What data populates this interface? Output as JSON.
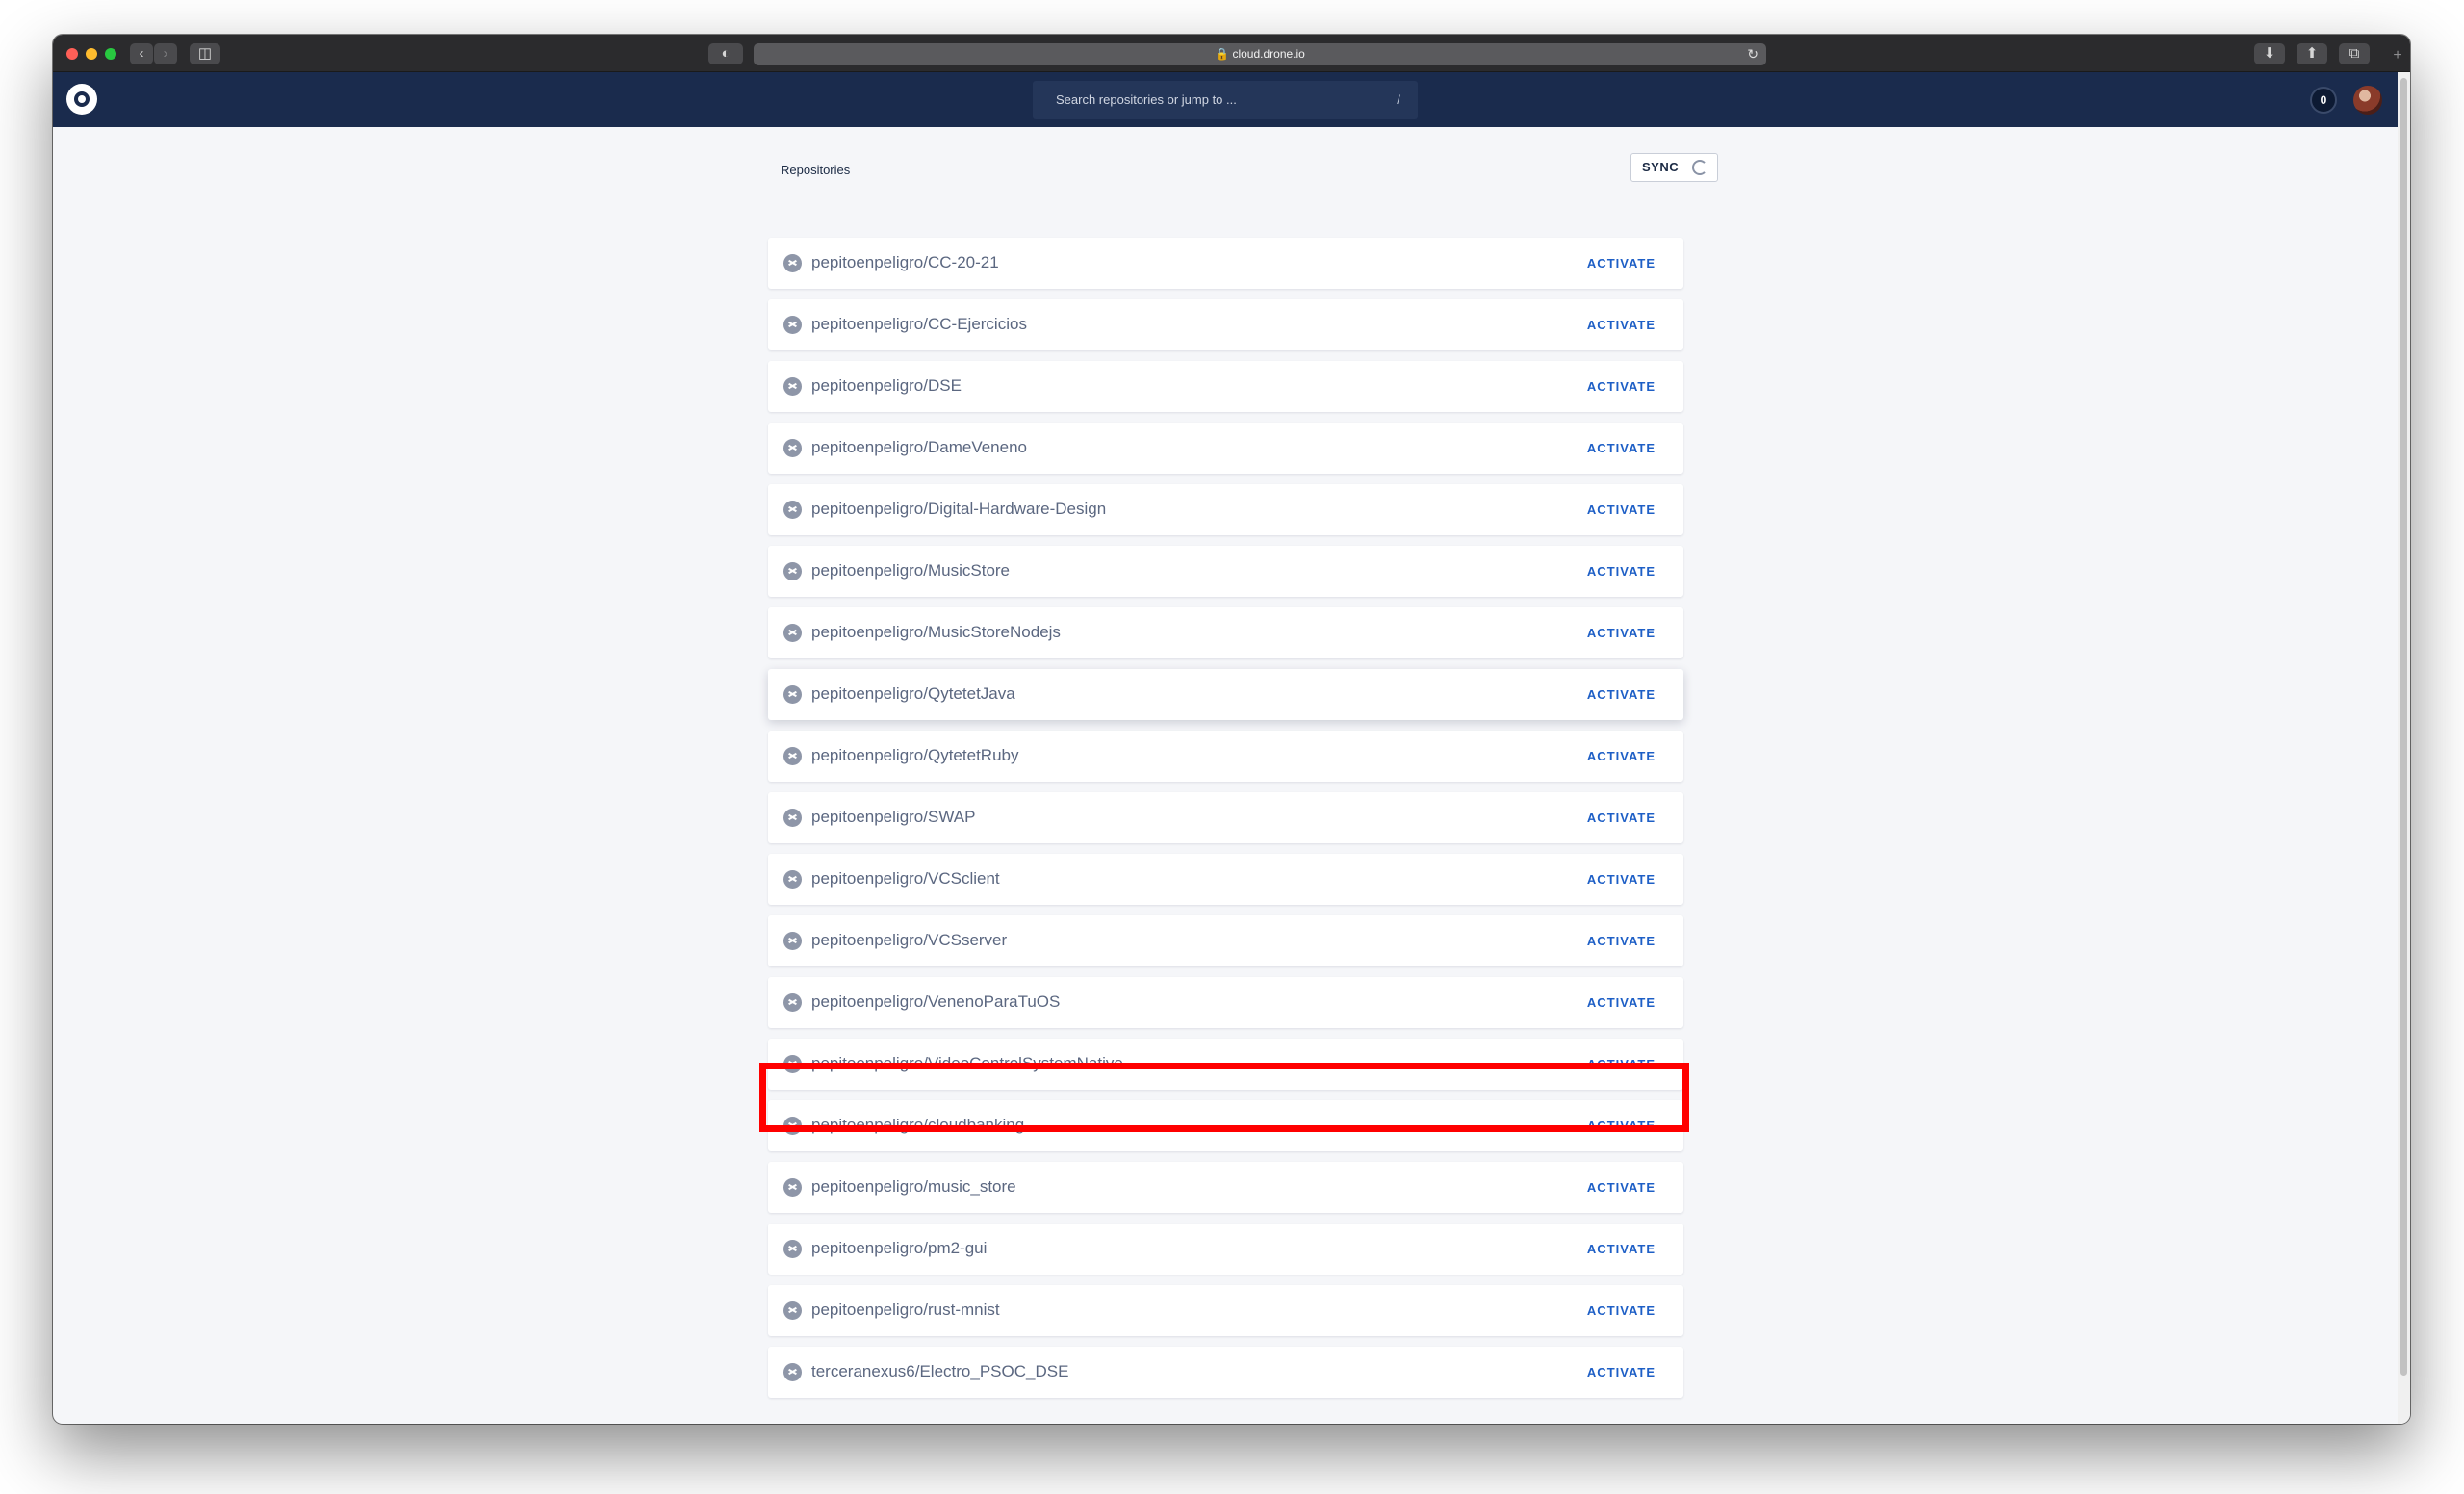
{
  "browser": {
    "url": "cloud.drone.io",
    "icons": {
      "back": "chevron-left-icon",
      "forward": "chevron-right-icon",
      "sidebar": "sidebar-icon",
      "privacy": "shield-icon",
      "lock": "lock-icon",
      "reload": "reload-icon",
      "download": "download-icon",
      "share": "share-icon",
      "tabs": "tabs-icon",
      "new_tab": "plus-icon"
    }
  },
  "header": {
    "search_placeholder": "Search repositories or jump to ...",
    "search_shortcut": "/",
    "notification_count": "0",
    "colors": {
      "background": "#1a2b4d"
    }
  },
  "repositories": {
    "title": "Repositories",
    "sync_label": "SYNC",
    "activate_label": "ACTIVATE",
    "items": [
      {
        "name": "pepitoenpeligro/CC-20-21"
      },
      {
        "name": "pepitoenpeligro/CC-Ejercicios"
      },
      {
        "name": "pepitoenpeligro/DSE"
      },
      {
        "name": "pepitoenpeligro/DameVeneno"
      },
      {
        "name": "pepitoenpeligro/Digital-Hardware-Design"
      },
      {
        "name": "pepitoenpeligro/MusicStore"
      },
      {
        "name": "pepitoenpeligro/MusicStoreNodejs"
      },
      {
        "name": "pepitoenpeligro/QytetetJava"
      },
      {
        "name": "pepitoenpeligro/QytetetRuby"
      },
      {
        "name": "pepitoenpeligro/SWAP"
      },
      {
        "name": "pepitoenpeligro/VCSclient"
      },
      {
        "name": "pepitoenpeligro/VCSserver"
      },
      {
        "name": "pepitoenpeligro/VenenoParaTuOS"
      },
      {
        "name": "pepitoenpeligro/VideoControlSystemNative"
      },
      {
        "name": "pepitoenpeligro/cloudbanking"
      },
      {
        "name": "pepitoenpeligro/music_store"
      },
      {
        "name": "pepitoenpeligro/pm2-gui"
      },
      {
        "name": "pepitoenpeligro/rust-mnist"
      },
      {
        "name": "terceranexus6/Electro_PSOC_DSE"
      }
    ],
    "colors": {
      "activate": "#1e5fc6",
      "highlight": "#ff0000"
    }
  }
}
